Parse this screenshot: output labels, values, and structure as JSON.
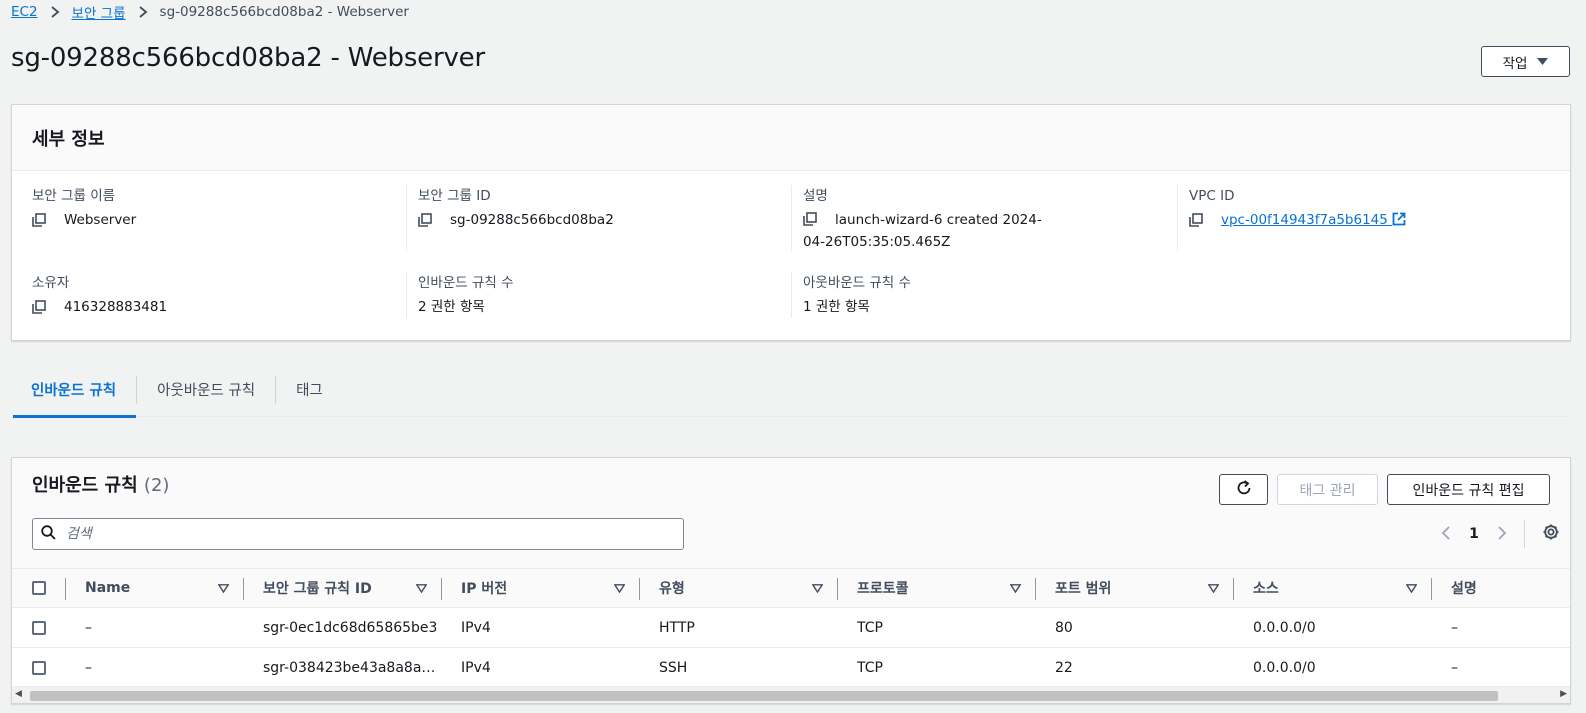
{
  "breadcrumb": {
    "items": [
      "EC2",
      "보안 그룹"
    ],
    "current": "sg-09288c566bcd08ba2 - Webserver"
  },
  "page": {
    "title": "sg-09288c566bcd08ba2 - Webserver",
    "actions_label": "작업"
  },
  "details": {
    "title": "세부 정보",
    "fields": {
      "sg_name": {
        "label": "보안 그룹 이름",
        "value": "Webserver"
      },
      "sg_id": {
        "label": "보안 그룹 ID",
        "value": "sg-09288c566bcd08ba2"
      },
      "description": {
        "label": "설명",
        "value": "launch-wizard-6 created 2024-04-26T05:35:05.465Z"
      },
      "vpc_id": {
        "label": "VPC ID",
        "value": "vpc-00f14943f7a5b6145"
      },
      "owner": {
        "label": "소유자",
        "value": "416328883481"
      },
      "inbound_count": {
        "label": "인바운드 규칙 수",
        "value": "2 권한 항목"
      },
      "outbound_count": {
        "label": "아웃바운드 규칙 수",
        "value": "1 권한 항목"
      }
    }
  },
  "tabs": [
    "인바운드 규칙",
    "아웃바운드 규칙",
    "태그"
  ],
  "rules": {
    "title": "인바운드 규칙",
    "count": "(2)",
    "manage_tags_label": "태그 관리",
    "edit_label": "인바운드 규칙 편집",
    "search_placeholder": "검색",
    "page_number": "1",
    "columns": [
      "Name",
      "보안 그룹 규칙 ID",
      "IP 버전",
      "유형",
      "프로토콜",
      "포트 범위",
      "소스",
      "설명"
    ],
    "rows": [
      [
        "–",
        "sgr-0ec1dc68d65865be3",
        "IPv4",
        "HTTP",
        "TCP",
        "80",
        "0.0.0.0/0",
        "–"
      ],
      [
        "–",
        "sgr-038423be43a8a8a…",
        "IPv4",
        "SSH",
        "TCP",
        "22",
        "0.0.0.0/0",
        "–"
      ]
    ]
  },
  "colors": {
    "link": "#0972d3",
    "text": "#16191f",
    "secondary_text": "#414d5c",
    "background": "#f1f2f2"
  },
  "icons": [
    "chevron-right-icon",
    "caret-down-icon",
    "copy-icon",
    "external-link-icon",
    "refresh-icon",
    "search-icon",
    "chevron-left-icon",
    "gear-icon",
    "sort-icon"
  ]
}
